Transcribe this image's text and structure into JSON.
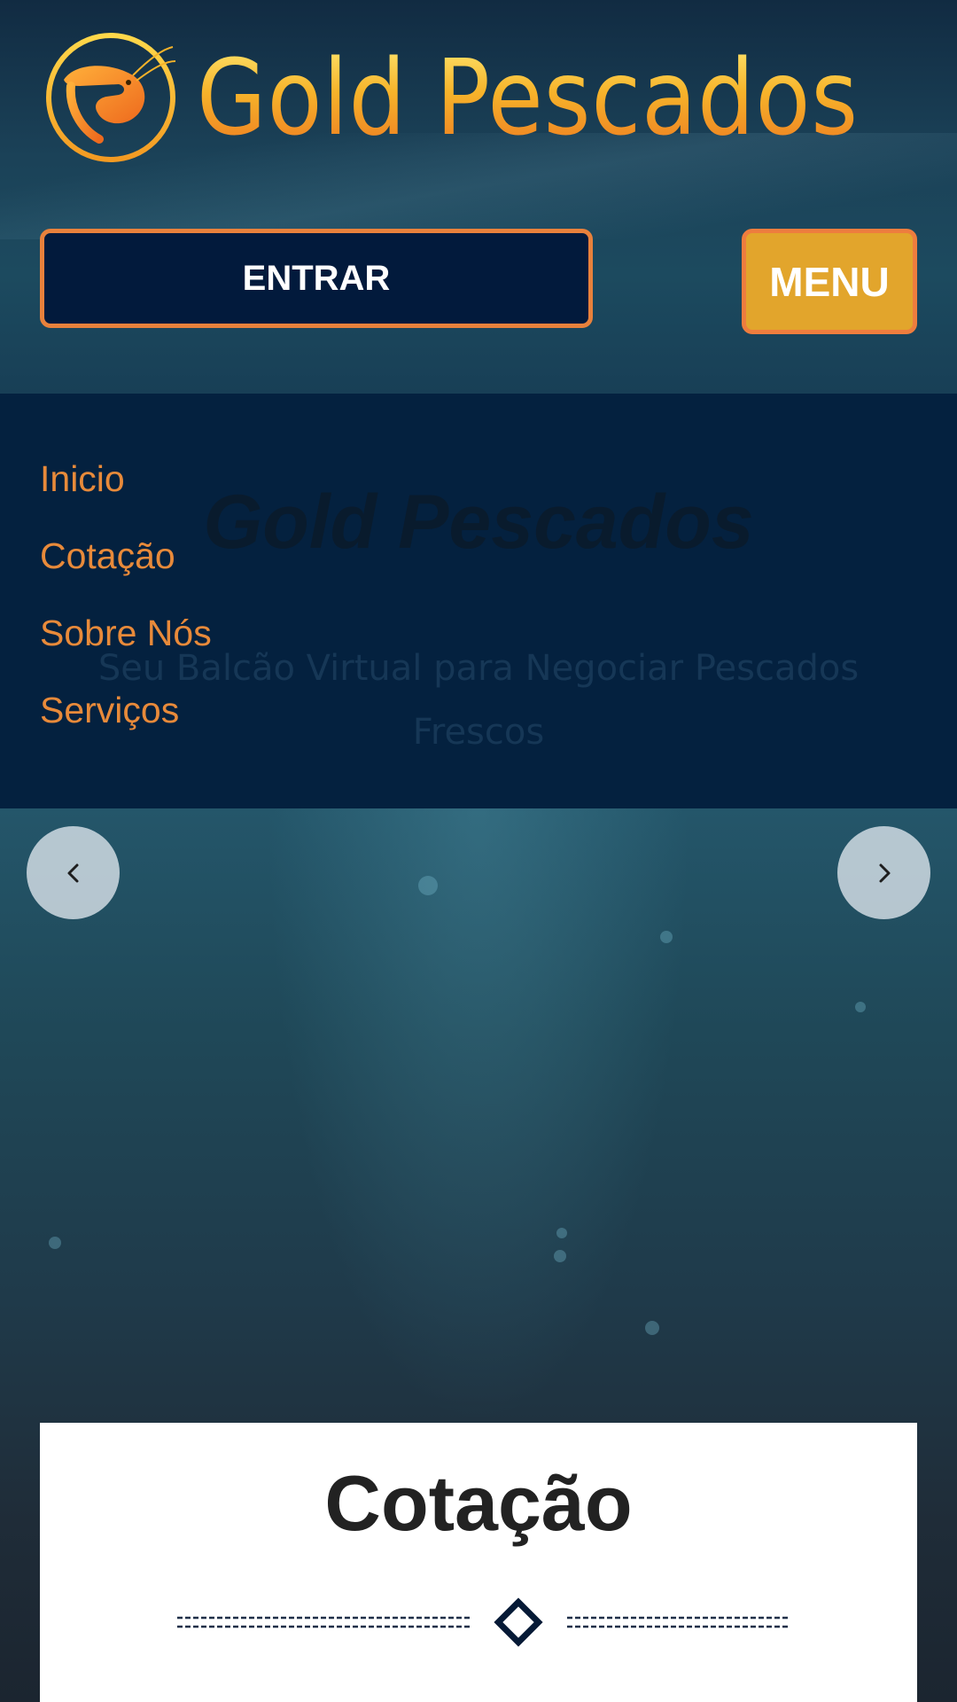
{
  "header": {
    "logo_text": "Gold Pescados",
    "logo_icon": "shrimp-icon",
    "login_label": "ENTRAR",
    "menu_label": "MENU"
  },
  "nav": {
    "items": [
      {
        "label": "Inicio"
      },
      {
        "label": "Cotação"
      },
      {
        "label": "Sobre Nós"
      },
      {
        "label": "Serviços"
      }
    ]
  },
  "hero": {
    "title": "Gold Pescados",
    "subtitle": "Seu Balcão Virtual para Negociar Pescados Frescos"
  },
  "carousel": {
    "prev_icon": "chevron-left-icon",
    "next_icon": "chevron-right-icon"
  },
  "section": {
    "title": "Cotação",
    "divider_icon": "diamond-icon"
  },
  "colors": {
    "accent_orange": "#e88a3a",
    "menu_button": "#e2a52c",
    "login_button": "#021a3c",
    "menu_panel": "#04213f",
    "logo_gold": "#f2b62a"
  }
}
